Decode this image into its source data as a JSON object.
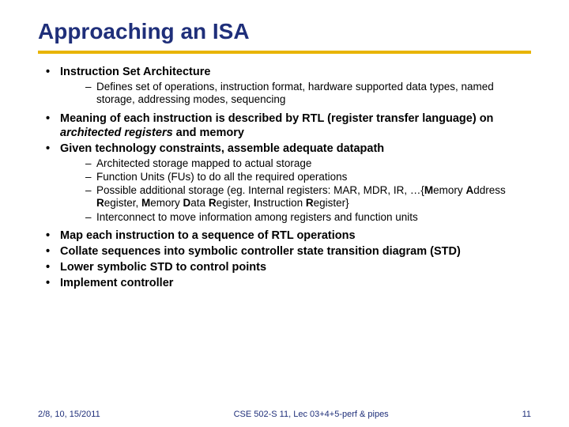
{
  "title": "Approaching an ISA",
  "bullets": {
    "b1": "Instruction Set Architecture",
    "b1_sub1": "Defines set of operations, instruction format, hardware supported data types, named storage, addressing modes, sequencing",
    "b2_pre": "Meaning of each instruction is described by RTL (register transfer language) on ",
    "b2_em": "architected registers",
    "b2_post": " and memory",
    "b3": "Given technology constraints, assemble adequate datapath",
    "b3_sub1": "Architected storage mapped to actual storage",
    "b3_sub2": "Function Units (FUs) to do all the required operations",
    "b3_sub3_a": "Possible additional storage (eg. Internal registers: MAR, MDR, IR, …{",
    "b3_sub3_b": "M",
    "b3_sub3_c": "emory ",
    "b3_sub3_d": "A",
    "b3_sub3_e": "ddress ",
    "b3_sub3_f": "R",
    "b3_sub3_g": "egister, ",
    "b3_sub3_h": "M",
    "b3_sub3_i": "emory ",
    "b3_sub3_j": "D",
    "b3_sub3_k": "ata ",
    "b3_sub3_l": "R",
    "b3_sub3_m": "egister, ",
    "b3_sub3_n": "I",
    "b3_sub3_o": "nstruction ",
    "b3_sub3_p": "R",
    "b3_sub3_q": "egister}",
    "b3_sub4": "Interconnect to move information among registers and function units",
    "b4": "Map each instruction to a sequence of RTL operations",
    "b5": "Collate sequences into symbolic controller state transition diagram (STD)",
    "b6": "Lower symbolic STD to control points",
    "b7": "Implement controller"
  },
  "footer": {
    "left": "2/8, 10, 15/2011",
    "center": "CSE 502-S 11, Lec 03+4+5-perf & pipes",
    "right": "11"
  }
}
